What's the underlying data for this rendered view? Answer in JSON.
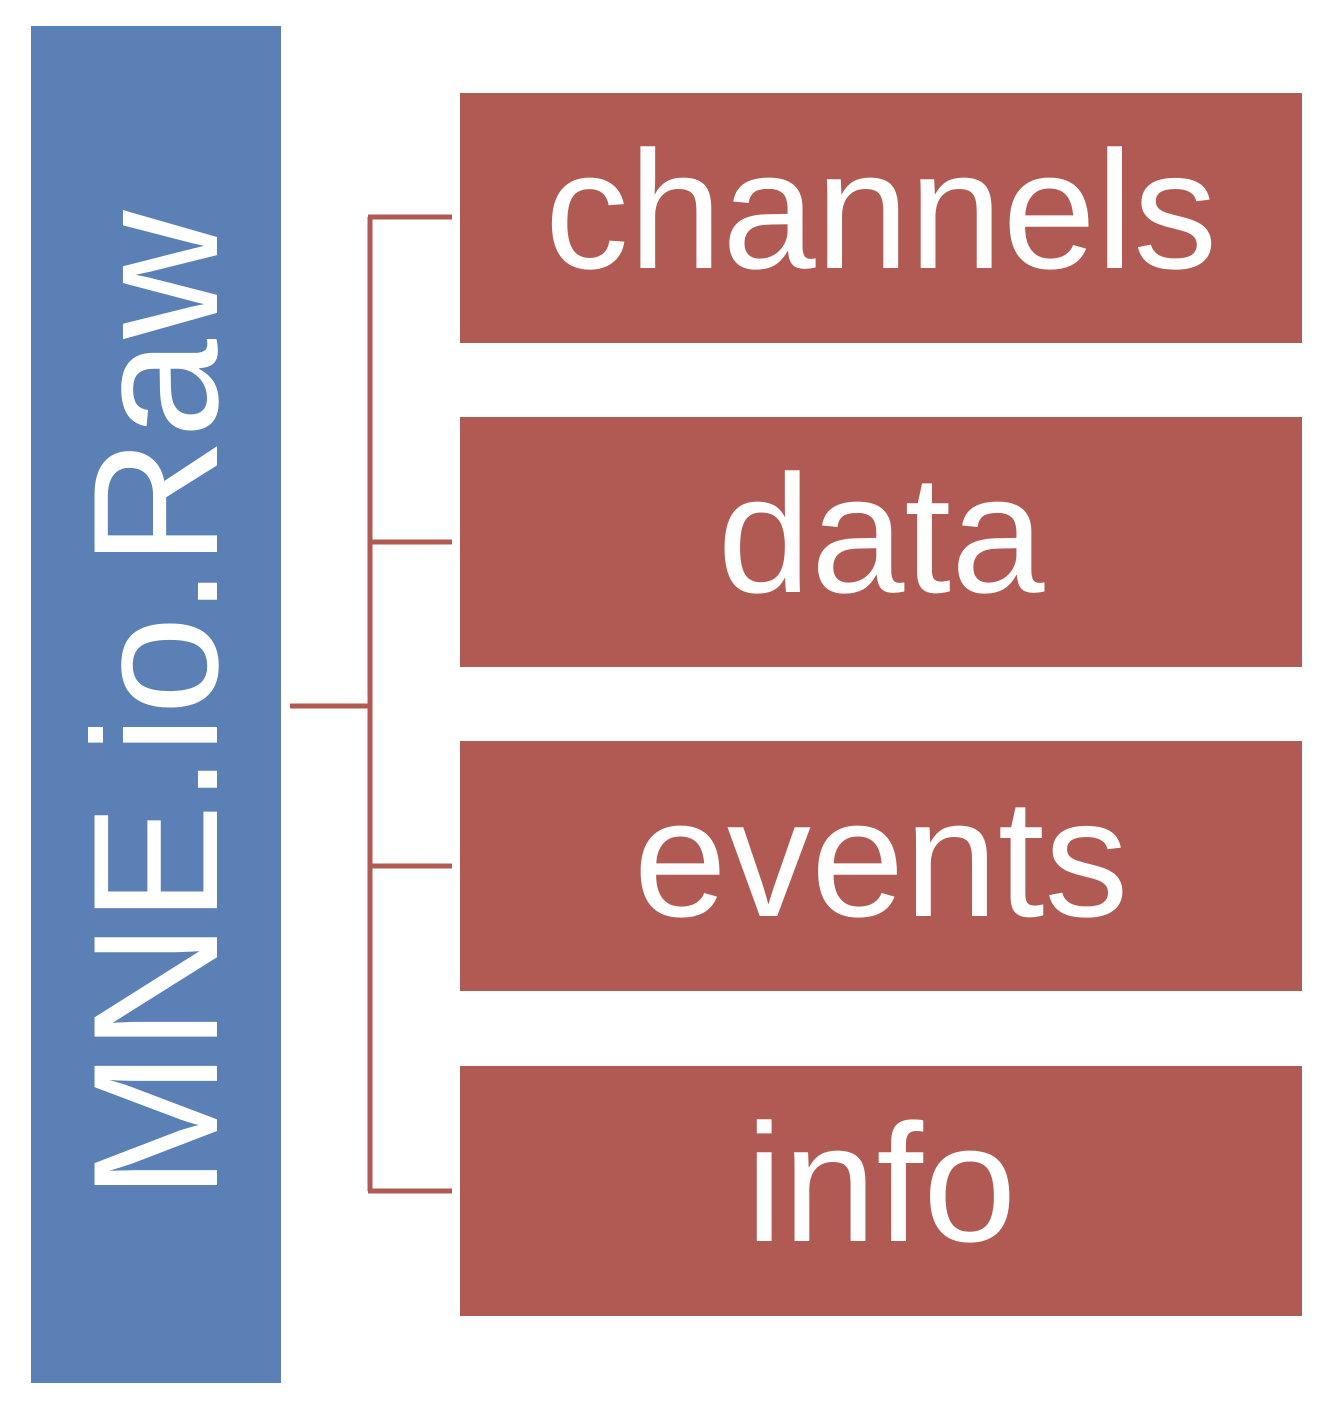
{
  "diagram": {
    "root": {
      "label": "MNE.io.Raw",
      "color": "#5b80b6"
    },
    "children": [
      {
        "label": "channels"
      },
      {
        "label": "data"
      },
      {
        "label": "events"
      },
      {
        "label": "info"
      }
    ],
    "child_color": "#b15a53",
    "connector_color": "#b15a53"
  }
}
